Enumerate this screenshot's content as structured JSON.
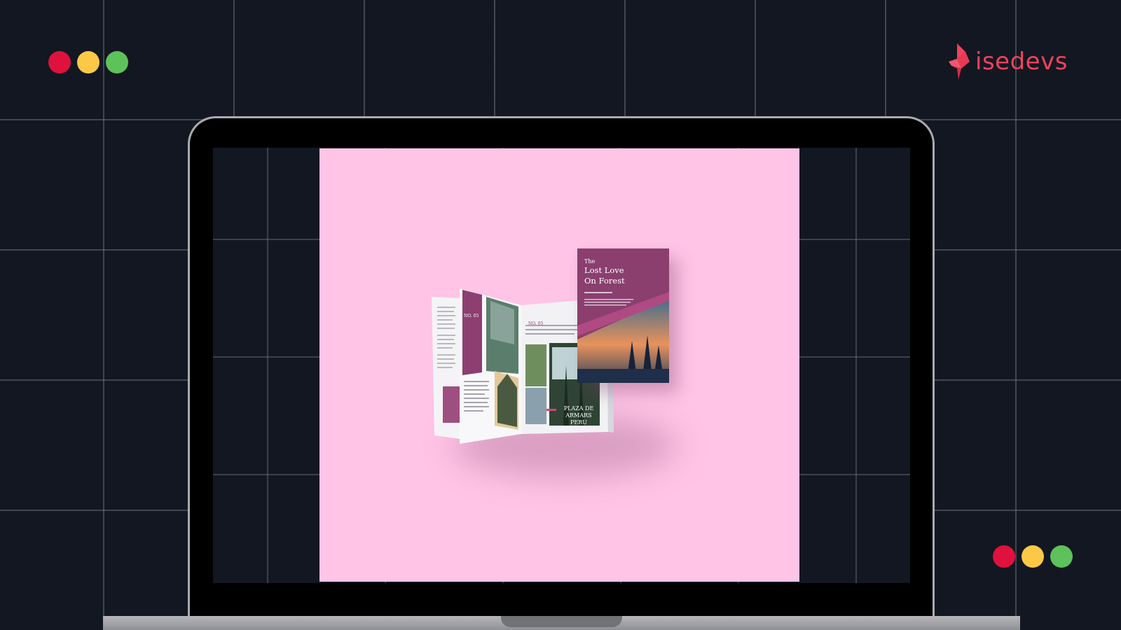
{
  "brand": {
    "name": "isedevs",
    "color": "#f0425c"
  },
  "decor": {
    "traffic_lights": [
      "#e0113d",
      "#fcc946",
      "#5dc25a"
    ]
  },
  "slide": {
    "background": "#ffc4e6",
    "cover": {
      "the": "The",
      "line1": "Lost Love",
      "line2": "On Forest"
    },
    "spread": {
      "label_left": "NO. 05",
      "label_right": "NO. 05",
      "photo_caption_line1": "PLAZA DE ARMARS",
      "photo_caption_line2": "PERU"
    }
  }
}
